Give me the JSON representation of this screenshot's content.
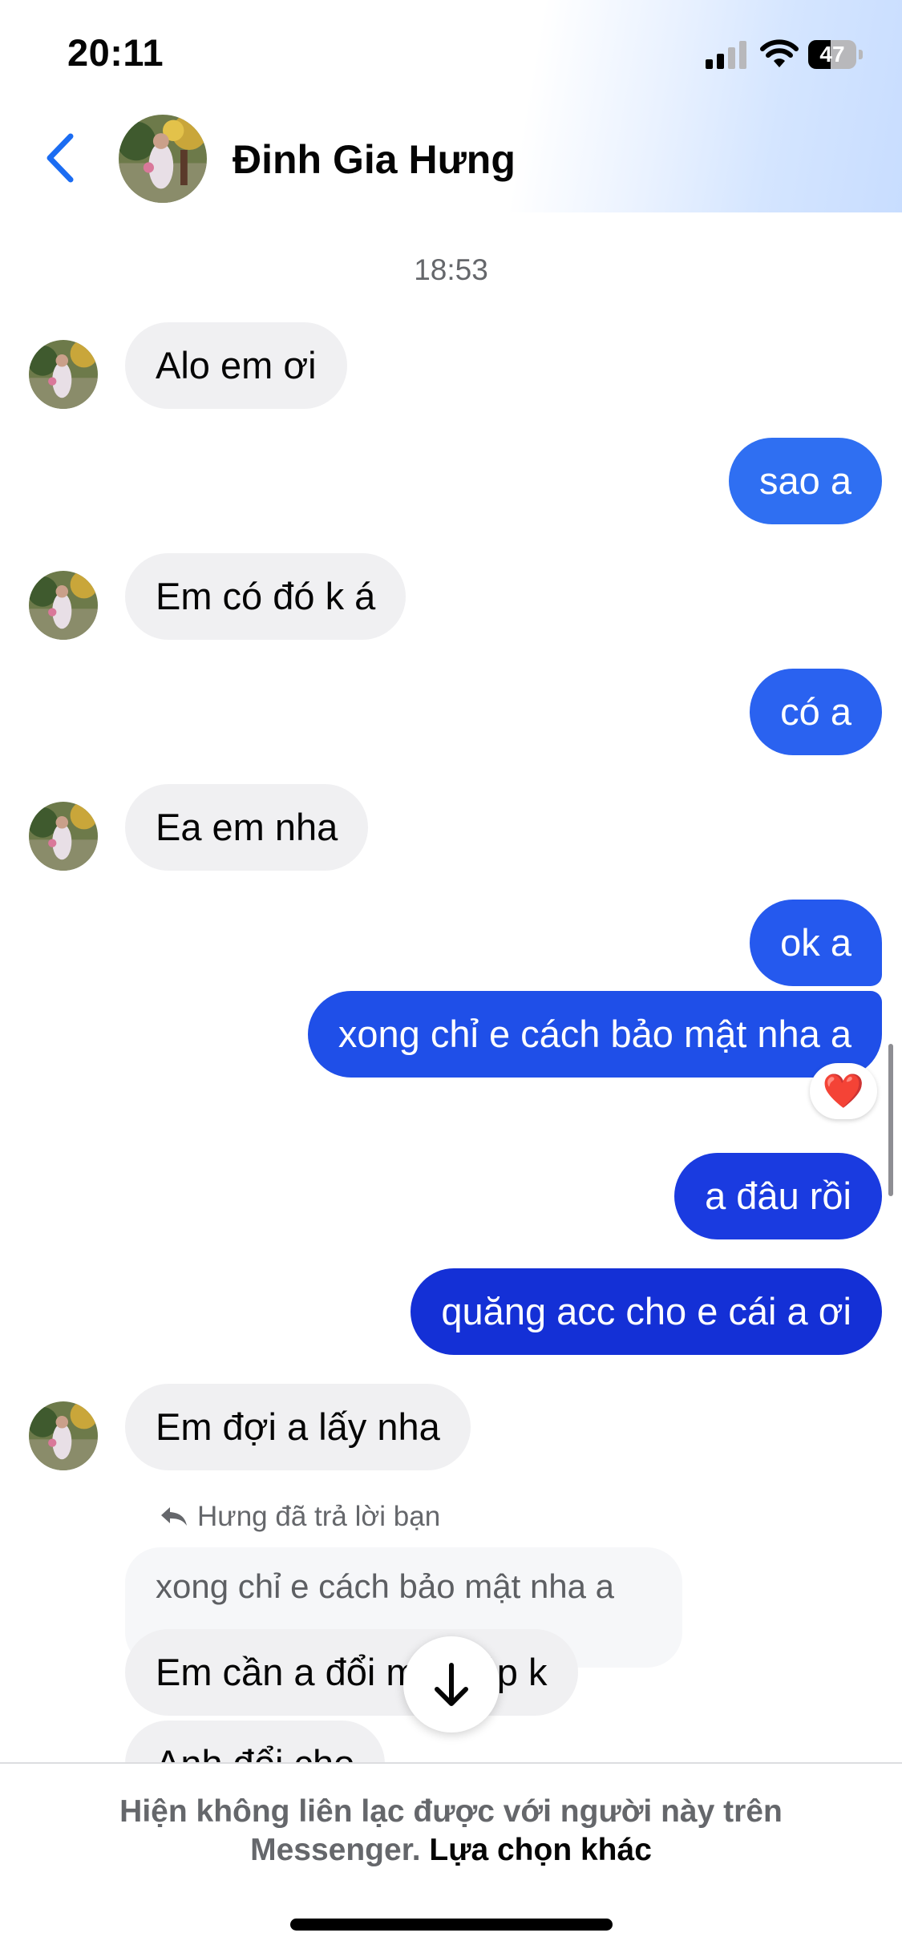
{
  "status_bar": {
    "time": "20:11",
    "battery_level": "47",
    "battery_fraction": 0.47
  },
  "header": {
    "back_icon": "chevron-left-icon",
    "contact_name": "Đinh Gia Hưng"
  },
  "conversation": {
    "timestamp": "18:53",
    "messages": [
      {
        "sender": "contact",
        "text": "Alo em ơi"
      },
      {
        "sender": "me",
        "text": "sao a",
        "color": "#2f6ff2"
      },
      {
        "sender": "contact",
        "text": "Em có đó k á"
      },
      {
        "sender": "me",
        "text": "có a",
        "color": "#2a62f0"
      },
      {
        "sender": "contact",
        "text": "Ea em nha"
      },
      {
        "sender": "me",
        "text": "ok a",
        "color": "#2559ee"
      },
      {
        "sender": "me",
        "text": "xong chỉ e cách bảo mật nha a",
        "color": "#1f4fe8",
        "reaction": "❤️"
      },
      {
        "sender": "me",
        "text": "a đâu rồi",
        "color": "#1a3be0"
      },
      {
        "sender": "me",
        "text": "quăng acc cho e cái a ơi",
        "color": "#1430d6"
      },
      {
        "sender": "contact",
        "text": "Em đợi a lấy nha"
      },
      {
        "sender": "contact",
        "text": "Em cần a đổi mk giúp k"
      },
      {
        "sender": "contact",
        "text": "Anh đổi cho"
      }
    ],
    "reply": {
      "note": "Hưng đã trả lời bạn",
      "quoted_text": "xong chỉ e cách bảo mật nha a",
      "icon": "reply-arrow-icon"
    },
    "scroll_button_icon": "arrow-down-icon"
  },
  "footer": {
    "notice": "Hiện không liên lạc được với người này trên Messenger.",
    "notice_line1": "Hiện không liên lạc được với người này trên",
    "notice_line2": "Messenger.",
    "link": "Lựa chọn khác"
  }
}
